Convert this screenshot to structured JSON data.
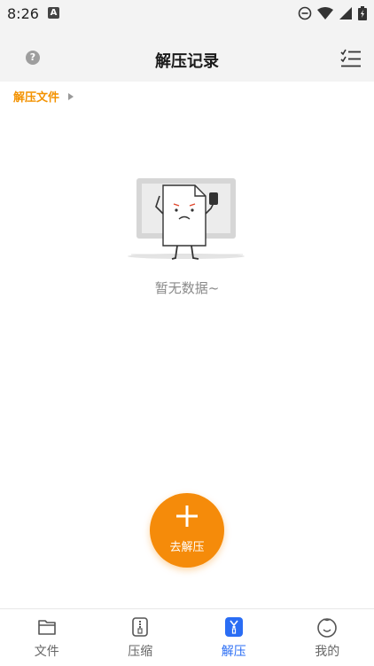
{
  "status_bar": {
    "time": "8:26",
    "notification_icon": "A"
  },
  "app_bar": {
    "title": "解压记录",
    "help_icon": "help-icon",
    "menu_icon": "list-menu-icon"
  },
  "breadcrumb": {
    "label": "解压文件"
  },
  "empty_state": {
    "text": "暂无数据~",
    "illustration": "sad-document-illustration"
  },
  "fab": {
    "label": "去解压",
    "icon": "plus-icon",
    "color": "#f58b0a"
  },
  "tabs": [
    {
      "label": "文件",
      "icon": "folder-icon",
      "active": false
    },
    {
      "label": "压缩",
      "icon": "zip-file-icon",
      "active": false
    },
    {
      "label": "解压",
      "icon": "unzip-icon",
      "active": true
    },
    {
      "label": "我的",
      "icon": "profile-face-icon",
      "active": false
    }
  ],
  "colors": {
    "accent": "#f39200",
    "active_tab": "#2a6df4",
    "app_bar_bg": "#f3f3f3"
  }
}
